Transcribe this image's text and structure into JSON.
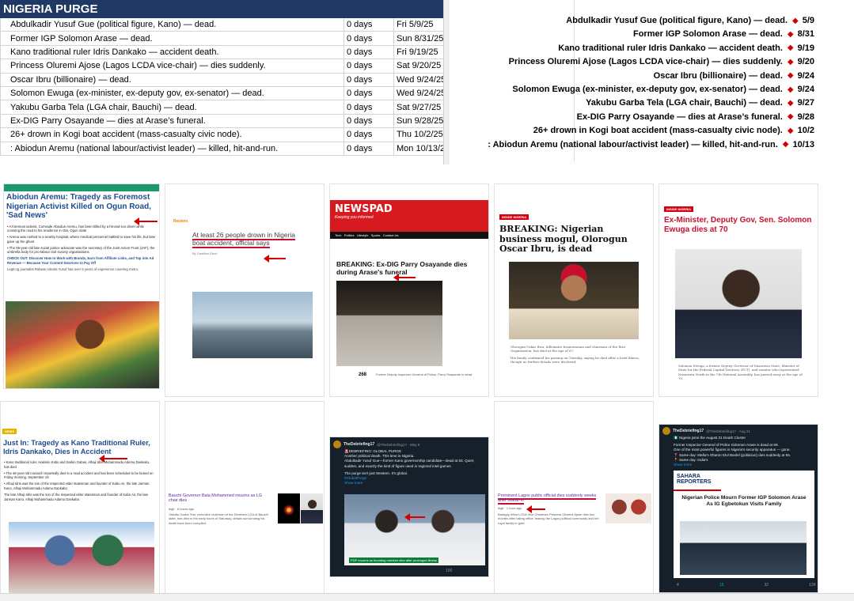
{
  "sheet": {
    "title": "NIGERIA PURGE",
    "rows": [
      {
        "event": "Abdulkadir Yusuf Gue (political figure, Kano) — dead.",
        "days": "0 days",
        "date": "Fri 5/9/25"
      },
      {
        "event": "Former IGP Solomon Arase — dead.",
        "days": "0 days",
        "date": "Sun 8/31/25"
      },
      {
        "event": "Kano traditional ruler Idris Dankako — accident death.",
        "days": "0 days",
        "date": "Fri 9/19/25"
      },
      {
        "event": "Princess Oluremi Ajose (Lagos LCDA vice-chair) — dies suddenly.",
        "days": "0 days",
        "date": "Sat 9/20/25"
      },
      {
        "event": "Oscar Ibru (billionaire) — dead.",
        "days": "0 days",
        "date": "Wed 9/24/25"
      },
      {
        "event": "Solomon Ewuga (ex-minister, ex-deputy gov, ex-senator) — dead.",
        "days": "0 days",
        "date": "Wed 9/24/25"
      },
      {
        "event": "Yakubu Garba Tela (LGA chair, Bauchi) — dead.",
        "days": "0 days",
        "date": "Sat 9/27/25"
      },
      {
        "event": "Ex-DIG Parry Osayande — dies at Arase’s funeral.",
        "days": "0 days",
        "date": "Sun 9/28/25"
      },
      {
        "event": "26+ drown in Kogi boat accident (mass-casualty civic node).",
        "days": "0 days",
        "date": "Thu 10/2/25"
      },
      {
        "event": ": Abiodun Aremu (national labour/activist leader) — killed, hit-and-run.",
        "days": "0 days",
        "date": "Mon 10/13/2"
      }
    ]
  },
  "timeline": {
    "items": [
      {
        "label": "Abdulkadir Yusuf Gue (political figure, Kano) — dead.",
        "date": "5/9"
      },
      {
        "label": "Former IGP Solomon Arase — dead.",
        "date": "8/31"
      },
      {
        "label": "Kano traditional ruler Idris Dankako — accident death.",
        "date": "9/19"
      },
      {
        "label": "Princess Oluremi Ajose (Lagos LCDA vice-chair) — dies suddenly.",
        "date": "9/20"
      },
      {
        "label": "Oscar Ibru (billionaire) — dead.",
        "date": "9/24"
      },
      {
        "label": "Solomon Ewuga (ex-minister, ex-deputy gov, ex-senator) — dead.",
        "date": "9/24"
      },
      {
        "label": "Yakubu Garba Tela (LGA chair, Bauchi) — dead.",
        "date": "9/27"
      },
      {
        "label": "Ex-DIG Parry Osayande — dies at Arase’s funeral.",
        "date": "9/28"
      },
      {
        "label": "26+ drown in Kogi boat accident (mass-casualty civic node).",
        "date": "10/2"
      },
      {
        "label": ": Abiodun Aremu (national labour/activist leader) — killed, hit-and-run.",
        "date": "10/13"
      }
    ]
  },
  "cards": {
    "aremu": {
      "nav": "NIGERIA   Lagos State   Abuja   Rivers State   Kano State   Oyo State   Anambra State",
      "headline": "Abiodun Aremu: Tragedy as Foremost Nigerian Activist Killed on Ogun Road, 'Sad News'",
      "bullet1": "• A foremost activist, Comrade Abiodun Aremu, has been killed by a hit-and-run driver while crossing the road to his residence in Ota, Ogun state",
      "bullet2": "• Aremu was rushed to a nearby hospital, where medical personnel battled to save his life, but later gave up the ghost",
      "bullet3": "• The 65-year-old late social justice advocate was the secretary of the Joint Action Front (JAF), the umbrella body for pro-labour civil society organisations",
      "check": "CHECK OUT: Discover How to Work with Brands, Earn from Affiliate Links, and Tap into Ad Revenue — Because Your Content Deserves to Pay Off",
      "byline": "Legit.ng journalist Ridwan Adeola Yusuf has over 9 years of experience covering metro."
    },
    "kogi": {
      "source": "Reuters",
      "headline": "At least 26 people drown in Nigeria boat accident, official says",
      "author": "By Camillus Eboh"
    },
    "osayande": {
      "brand": "NEWSPAD",
      "tagline": "Keeping you informed",
      "menu": "Tech   Politics   Lifestyle   Sports   Contact Us",
      "headline": "BREAKING: Ex-DIG Parry Osayande dies during Arase's funeral",
      "caption": "Former Deputy Inspector General of Police, Parry Osayande is dead",
      "count": "268"
    },
    "ibru": {
      "label": "INSIDE NIGERIA",
      "headline": "BREAKING: Nigerian business mogul, Olorogun Oscar Ibru, is dead",
      "body": "Olorogun Oskar Ibru, billionaire businessman and chairman of the Ibru Organisation, has died at the age of 67.",
      "body2": "His family confirmed his passing on Tuesday, saying he died after a brief illness, though no further details were disclosed."
    },
    "ewuga": {
      "label": "INSIDE NIGERIA",
      "headline": "Ex-Minister, Deputy Gov, Sen. Solomon Ewuga dies at 70",
      "body": "Solomon Ewuga, a former Deputy Governor of Nasarawa State, Minister of State for the Federal Capital Territory (FCT), and senator who represented Nasarawa North in the 7th National Assembly, has passed away at the age of 70."
    },
    "dankako": {
      "label": "NEWS",
      "headline": "Just In: Tragedy as Kano Traditional Ruler, Idris Dankako, Dies in Accident",
      "bullet1": "• Kano traditional ruler, Hakimin Kabo and Sarkin Gabas, Alhaji Idris Muhammadu Ademu Dankako, has died",
      "bullet2": "• The 48-year-old monarch reportedly died in a road accident and has been scheduled to be buried on Friday morning, September 19",
      "bullet3": "• Alhaji Idris was the son of the respected elder statesman and founder of Kabo Air, the late Jarman Kano, Alhaji Muhammadu Adamu Dankabo",
      "body": "The late Alhaji Idris was the son of the respected elder statesman and founder of Kabo Air, the late Jarman Kano, Alhaji Muhammadu Adamu Dankabo."
    },
    "tela": {
      "headline": "Bauchi Governor Bala Mohammed mourns as LG chair dies",
      "source": "legit · 6 hours ago",
      "body": "Yakubu Garba Tela, executive chairman of the Dembem LGA of Bauchi state, has died in the early hours of Saturday, details surrounding his death have been compiled."
    },
    "gue": {
      "account": "TheDebriefing17",
      "handle": "@TheDebriefing17 · May 9",
      "line1": "🚨DEBRIEFING: GLOBAL PURGE",
      "line2": "Another political death. This time in Nigeria.",
      "line3": "Abdulkadir Yusuf Gue—former Kano governorship candidate—dead at 63. Quiet, sudden, and exactly the kind of figure used in regional intel games.",
      "line4": "The purge isn't just Western. It's global.",
      "hashtag": "#GlobalPurge",
      "more": "Show more",
      "caption": "PDP mourns as founding member dies after prolonged illness",
      "likes": "100"
    },
    "ajose": {
      "headline": "Prominent Lagos public official dies suddenly weeks after swear-in",
      "source": "legit · 1 hour ago",
      "body": "Badagry West LCDA Vice Chairman Princess Oluremi Ajose dies two months after taking office, leaving the Lagos political community and her royal family in grief."
    },
    "arase": {
      "account": "TheDebriefing17",
      "handle": "@TheDebriefing17 · Aug 31",
      "line1": "🇳🇬 Nigeria joins the August 31 Death Cluster",
      "line2": "Former Inspector General of Police Solomon Arase is dead at 69.",
      "line3": "One of the most powerful figures in Nigeria's security apparatus — gone.",
      "line4": "📍 Same day: Mafia's Sharon Elul Bonlel (politician) dies suddenly at 55.",
      "line5": "📍 Same day: India's",
      "more": "Show more",
      "brand": "SAHARA REPORTERS",
      "news": "Nigerian Police Mourn Former IGP Solomon Arase As IG Egbetokun Visits Family",
      "c1": "4",
      "c2": "15",
      "c3": "32",
      "c4": "12K"
    }
  },
  "colors": {
    "sheet_header": "#1f3864",
    "accent_red": "#d40000",
    "diamond": "#d10000"
  }
}
